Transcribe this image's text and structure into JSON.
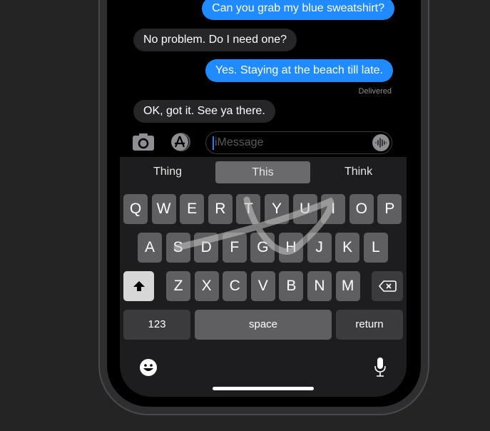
{
  "messages": [
    {
      "text": "Can you grab my blue sweatshirt?",
      "direction": "outgoing"
    },
    {
      "text": "No problem. Do I need one?",
      "direction": "incoming"
    },
    {
      "text": "Yes. Staying at the beach till late.",
      "direction": "outgoing"
    },
    {
      "text": "OK, got it. See ya there.",
      "direction": "incoming"
    }
  ],
  "status": "Delivered",
  "input": {
    "placeholder": "iMessage",
    "camera_icon": "camera-icon",
    "apps_icon": "app-store-icon",
    "audio_icon": "waveform-icon"
  },
  "suggestions": [
    "Thing",
    "This",
    "Think"
  ],
  "selected_suggestion": "This",
  "keyboard": {
    "row1": [
      "Q",
      "W",
      "E",
      "R",
      "T",
      "Y",
      "U",
      "I",
      "O",
      "P"
    ],
    "row2": [
      "A",
      "S",
      "D",
      "F",
      "G",
      "H",
      "J",
      "K",
      "L"
    ],
    "row3": [
      "Z",
      "X",
      "C",
      "V",
      "B",
      "N",
      "M"
    ],
    "numbers": "123",
    "space": "space",
    "return": "return"
  },
  "colors": {
    "outgoing": "#1f8bff",
    "incoming": "#262629",
    "key": "#5f5f61"
  }
}
